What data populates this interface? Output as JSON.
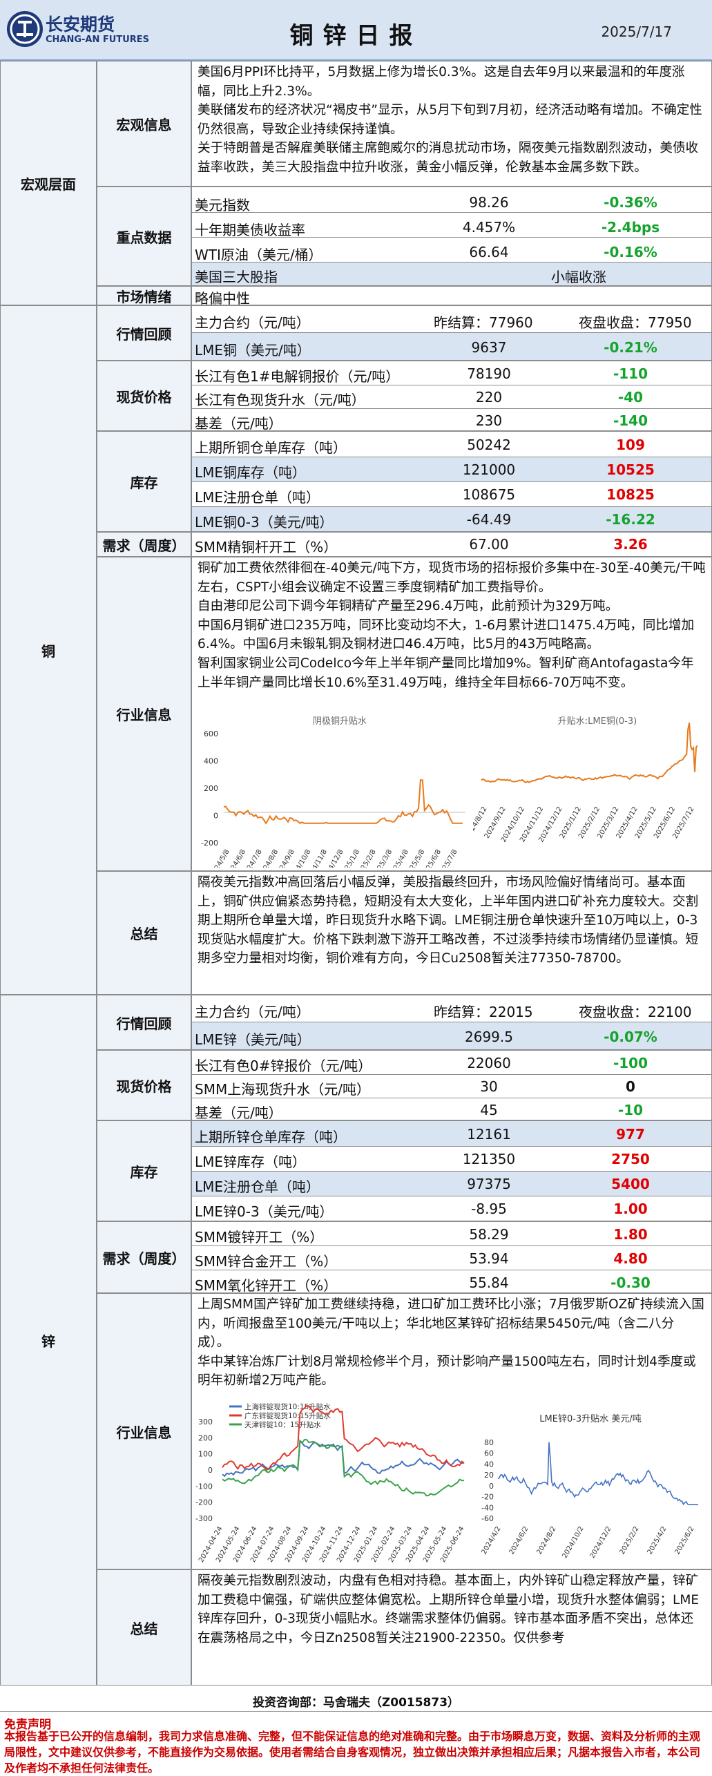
{
  "header": {
    "company_cn": "长安期货",
    "company_en": "CHANG-AN FUTURES",
    "title": "铜锌日报",
    "date": "2025/7/17"
  },
  "macro": {
    "category": "宏观层面",
    "info_label": "宏观信息",
    "info": [
      "美国6月PPI环比持平，5月数据上修为增长0.3%。这是自去年9月以来最温和的年度涨幅，同比上升2.3%。",
      "美联储发布的经济状况“褐皮书”显示，从5月下旬到7月初，经济活动略有增加。不确定性仍然很高，导致企业持续保持谨慎。",
      "关于特朗普是否解雇美联储主席鲍威尔的消息扰动市场，隔夜美元指数剧烈波动，美债收益率收跌，美三大股指盘中拉升收涨，黄金小幅反弹，伦敦基本金属多数下跌。"
    ],
    "data_label": "重点数据",
    "data": [
      {
        "name": "美元指数",
        "value": "98.26",
        "change": "-0.36%",
        "color": "grn"
      },
      {
        "name": "十年期美债收益率",
        "value": "4.457%",
        "change": "-2.4bps",
        "color": "grn"
      },
      {
        "name": "WTI原油（美元/桶）",
        "value": "66.64",
        "change": "-0.16%",
        "color": "grn"
      }
    ],
    "stocks_name": "美国三大股指",
    "stocks_value": "小幅收涨",
    "sentiment_label": "市场情绪",
    "sentiment": "略偏中性"
  },
  "copper": {
    "category": "铜",
    "review_label": "行情回顾",
    "main_name": "主力合约（元/吨）",
    "main_close": "昨结算：77960",
    "main_night": "夜盘收盘：77950",
    "lme_name": "LME铜（美元/吨）",
    "lme_value": "9637",
    "lme_change": "-0.21%",
    "spot_label": "现货价格",
    "spot": [
      {
        "name": "长江有色1#电解铜报价（元/吨）",
        "value": "78190",
        "change": "-110",
        "color": "grn"
      },
      {
        "name": "长江有色现货升水（元/吨）",
        "value": "220",
        "change": "-40",
        "color": "grn"
      },
      {
        "name": "基差（元/吨）",
        "value": "230",
        "change": "-140",
        "color": "grn"
      }
    ],
    "stock_label": "库存",
    "stock": [
      {
        "name": "上期所铜仓单库存（吨）",
        "value": "50242",
        "change": "109",
        "color": "red"
      },
      {
        "name": "LME铜库存（吨）",
        "value": "121000",
        "change": "10525",
        "color": "red"
      },
      {
        "name": "LME注册仓单（吨）",
        "value": "108675",
        "change": "10825",
        "color": "red"
      },
      {
        "name": "LME铜0-3（美元/吨）",
        "value": "-64.49",
        "change": "-16.22",
        "color": "grn"
      }
    ],
    "demand_label": "需求（周度）",
    "demand": {
      "name": "SMM精铜杆开工（%）",
      "value": "67.00",
      "change": "3.26",
      "color": "red"
    },
    "industry_label": "行业信息",
    "industry": [
      "铜矿加工费依然徘徊在-40美元/吨下方，现货市场的招标报价多集中在-30至-40美元/干吨左右，CSPT小组会议确定不设置三季度铜精矿加工费指导价。",
      "自由港印尼公司下调今年铜精矿产量至296.4万吨，此前预计为329万吨。",
      "中国6月铜矿进口235万吨，同环比变动均不大，1-6月累计进口1475.4万吨，同比增加6.4%。中国6月未锻轧铜及铜材进口46.4万吨，比5月的43万吨略高。",
      "智利国家铜业公司Codelco今年上半年铜产量同比增加9%。智利矿商Antofagasta今年上半年铜产量同比增长10.6%至31.49万吨，维持全年目标66-70万吨不变。"
    ],
    "chart1": {
      "title": "阴极铜升贴水",
      "ylim": [
        -200,
        600
      ],
      "yticks": [
        "600",
        "400",
        "200",
        "0",
        "-200"
      ],
      "xticks": [
        "2024/5/8",
        "2024/6/8",
        "2024/7/8",
        "2024/8/8",
        "2024/9/8",
        "2024/10/8",
        "2024/11/8",
        "2024/12/8",
        "2025/1/8",
        "2025/2/8",
        "2025/3/8",
        "2025/4/8",
        "2025/5/8",
        "2025/6/8",
        "2025/7/8"
      ]
    },
    "chart2": {
      "title": "升贴水:LME铜(0-3)",
      "xticks": [
        "2024/8/12",
        "2024/9/12",
        "2024/10/12",
        "2024/11/12",
        "2024/12/12",
        "2025/1/12",
        "2025/2/12",
        "2025/3/12",
        "2025/4/12",
        "2025/5/12",
        "2025/6/12",
        "2025/7/12"
      ]
    },
    "summary_label": "总结",
    "summary": "隔夜美元指数冲高回落后小幅反弹，美股指最终回升，市场风险偏好情绪尚可。基本面上，铜矿供应偏紧态势持稳，短期没有太大变化，上半年国内进口矿补充力度较大。交割期上期所仓单量大增，昨日现货升水略下调。LME铜注册仓单快速升至10万吨以上，0-3现货贴水幅度扩大。价格下跌刺激下游开工略改善，不过淡季持续市场情绪仍显谨慎。短期多空力量相对均衡，铜价难有方向，今日Cu2508暂关注77350-78700。"
  },
  "zinc": {
    "category": "锌",
    "review_label": "行情回顾",
    "main_name": "主力合约（元/吨）",
    "main_close": "昨结算：22015",
    "main_night": "夜盘收盘：22100",
    "lme_name": "LME锌（美元/吨）",
    "lme_value": "2699.5",
    "lme_change": "-0.07%",
    "spot_label": "现货价格",
    "spot": [
      {
        "name": "长江有色0#锌报价（元/吨）",
        "value": "22060",
        "change": "-100",
        "color": "grn"
      },
      {
        "name": "SMM上海现货升水（元/吨）",
        "value": "30",
        "change": "0",
        "color": "blk"
      },
      {
        "name": "基差（元/吨）",
        "value": "45",
        "change": "-10",
        "color": "grn"
      }
    ],
    "stock_label": "库存",
    "stock": [
      {
        "name": "上期所锌仓单库存（吨）",
        "value": "12161",
        "change": "977",
        "color": "red"
      },
      {
        "name": "LME锌库存（吨）",
        "value": "121350",
        "change": "2750",
        "color": "red"
      },
      {
        "name": "LME注册仓单（吨）",
        "value": "97375",
        "change": "5400",
        "color": "red"
      },
      {
        "name": "LME锌0-3（美元/吨）",
        "value": "-8.95",
        "change": "1.00",
        "color": "red"
      }
    ],
    "demand_label": "需求（周度）",
    "demand": [
      {
        "name": "SMM镀锌开工（%）",
        "value": "58.29",
        "change": "1.80",
        "color": "red"
      },
      {
        "name": "SMM锌合金开工（%）",
        "value": "53.94",
        "change": "4.80",
        "color": "red"
      },
      {
        "name": "SMM氧化锌开工（%）",
        "value": "55.84",
        "change": "-0.30",
        "color": "grn"
      }
    ],
    "industry_label": "行业信息",
    "industry": [
      "上周SMM国产锌矿加工费继续持稳，进口矿加工费环比小涨；7月俄罗斯OZ矿持续流入国内，听闻报盘至100美元/干吨以上；华北地区某锌矿招标结果5450元/吨（含二八分成）。",
      "华中某锌冶炼厂计划8月常规检修半个月，预计影响产量1500吨左右，同时计划4季度或明年初新增2万吨产能。"
    ],
    "chart1": {
      "legend": [
        "上海锌锭现货10:15升贴水",
        "广东锌锭现货10:15升贴水",
        "天津锌锭10：15升贴水"
      ],
      "yticks": [
        "300",
        "200",
        "100",
        "0",
        "-100",
        "-200",
        "-300"
      ],
      "xticks": [
        "2024-04-24",
        "2024-05-24",
        "2024-06-24",
        "2024-07-24",
        "2024-08-24",
        "2024-09-24",
        "2024-10-24",
        "2024-11-24",
        "2024-12-24",
        "2025-01-24",
        "2025-02-24",
        "2025-03-24",
        "2025-04-24",
        "2025-05-24",
        "2025-06-24"
      ]
    },
    "chart2": {
      "title": "LME锌0-3升贴水 美元/吨",
      "yticks": [
        "80",
        "60",
        "40",
        "20",
        "0",
        "-20",
        "-40",
        "-60"
      ],
      "xticks": [
        "2024/4/2",
        "2024/6/2",
        "2024/8/2",
        "2024/10/2",
        "2024/12/2",
        "2025/2/2",
        "2025/4/2",
        "2025/6/2"
      ]
    },
    "summary_label": "总结",
    "summary": "隔夜美元指数剧烈波动，内盘有色相对持稳。基本面上，内外锌矿山稳定释放产量，锌矿加工费稳中偏强，矿端供应整体偏宽松。上期所锌仓单量小增，现货升水整体偏弱；LME锌库存回升，0-3现货小幅贴水。终端需求整体仍偏弱。锌市基本面矛盾不突出，总体还在震荡格局之中，今日Zn2508暂关注21900-22350。仅供参考"
  },
  "footer": {
    "contact": "投资咨询部：马舍瑞夫（Z0015873）",
    "disclaimer_title": "免责声明",
    "disclaimer": "本报告基于已公开的信息编制，我司力求信息准确、完整，但不能保证信息的绝对准确和完整。由于市场瞬息万变，数据、资料及分析师的主观局限性，文中建议仅供参考，不能直接作为交易依据。使用者需结合自身客观情况，独立做出决策并承担相应后果；凡据本报告入市者，本公司及作者均不承担任何法律责任。"
  }
}
